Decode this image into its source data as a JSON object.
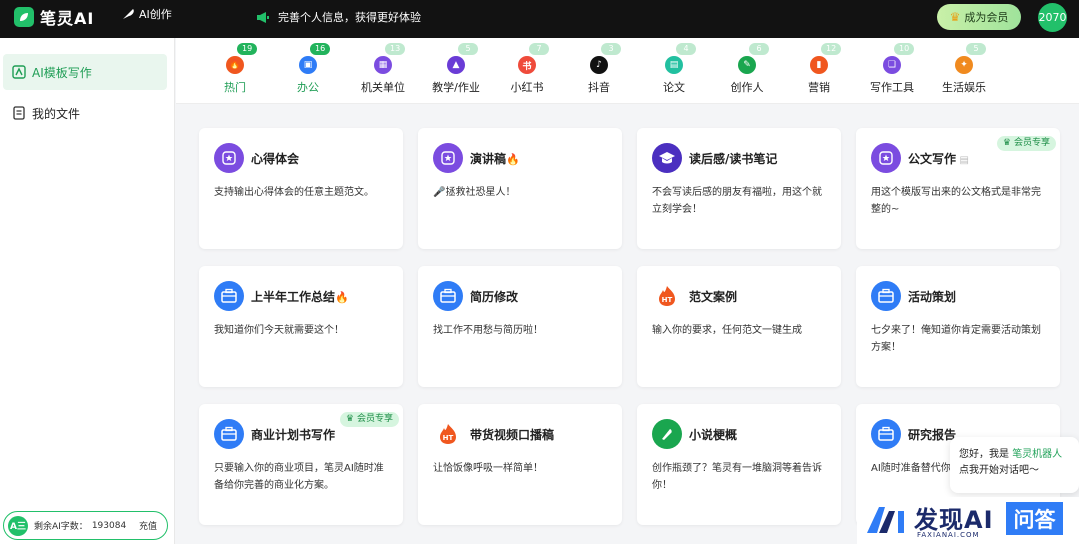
{
  "app": {
    "name": "笔灵AI"
  },
  "topbar": {
    "ai_create": "AI创作",
    "notice": "完善个人信息，获得更好体验",
    "vip_button": "成为会员",
    "user_avatar_text": "2070"
  },
  "sidebar": {
    "items": [
      {
        "label": "AI模板写作",
        "icon": "ai-template-icon",
        "active": true
      },
      {
        "label": "我的文件",
        "icon": "file-icon",
        "active": false
      }
    ],
    "words": {
      "icon_text": "A三",
      "label": "剩余AI字数：",
      "count": "193084",
      "recharge": "充值"
    }
  },
  "tabs": [
    {
      "label": "热门",
      "badge": "19",
      "icon": "fire-icon",
      "color": "#f0571f",
      "active": true
    },
    {
      "label": "办公",
      "badge": "16",
      "icon": "briefcase-icon",
      "color": "#2f7cf6",
      "active": true
    },
    {
      "label": "机关单位",
      "badge": "13",
      "icon": "government-icon",
      "color": "#7b4ce0",
      "active": false
    },
    {
      "label": "教学/作业",
      "badge": "5",
      "icon": "graduation-cap-icon",
      "color": "#6a3cd6",
      "active": false
    },
    {
      "label": "小红书",
      "badge": "7",
      "icon": "xiaohongshu-icon",
      "color": "#ef4b3b",
      "active": false
    },
    {
      "label": "抖音",
      "badge": "3",
      "icon": "tiktok-icon",
      "color": "#111111",
      "active": false
    },
    {
      "label": "论文",
      "badge": "4",
      "icon": "paper-icon",
      "color": "#22c0a0",
      "active": false
    },
    {
      "label": "创作人",
      "badge": "6",
      "icon": "pen-icon",
      "color": "#1aa64f",
      "active": false
    },
    {
      "label": "营销",
      "badge": "12",
      "icon": "marketing-icon",
      "color": "#f0571f",
      "active": false
    },
    {
      "label": "写作工具",
      "badge": "10",
      "icon": "writing-tool-icon",
      "color": "#7b4ce0",
      "active": false
    },
    {
      "label": "生活娱乐",
      "badge": "5",
      "icon": "lifestyle-icon",
      "color": "#f08a1f",
      "active": false
    }
  ],
  "cards": [
    {
      "title": "心得体会",
      "desc": "支持输出心得体会的任意主题范文。",
      "icon": "star-badge-icon",
      "color": "#7b4ce0",
      "fire": false,
      "vip": false
    },
    {
      "title": "演讲稿",
      "desc": "🎤拯救社恐星人！",
      "icon": "star-badge-icon",
      "color": "#7b4ce0",
      "fire": true,
      "vip": false
    },
    {
      "title": "读后感/读书笔记",
      "desc": "不会写读后感的朋友有福啦，用这个就立刻学会！",
      "icon": "graduation-cap-icon",
      "color": "#4b2fc0",
      "fire": false,
      "vip": false
    },
    {
      "title": "公文写作",
      "desc": "用这个模版写出来的公文格式是非常完整的~",
      "icon": "star-badge-icon",
      "color": "#7b4ce0",
      "fire": false,
      "vip": true,
      "doc": true
    },
    {
      "title": "上半年工作总结",
      "desc": "我知道你们今天就需要这个！",
      "icon": "briefcase-icon",
      "color": "#2f7cf6",
      "fire": true,
      "vip": false
    },
    {
      "title": "简历修改",
      "desc": "找工作不用愁与简历啦！",
      "icon": "briefcase-icon",
      "color": "#2f7cf6",
      "fire": false,
      "vip": false
    },
    {
      "title": "范文案例",
      "desc": "输入你的要求，任何范文一键生成",
      "icon": "ht-fire-icon",
      "color": "#f0571f",
      "fire": false,
      "vip": false
    },
    {
      "title": "活动策划",
      "desc": "七夕来了！俺知道你肯定需要活动策划方案！",
      "icon": "briefcase-icon",
      "color": "#2f7cf6",
      "fire": false,
      "vip": false
    },
    {
      "title": "商业计划书写作",
      "desc": "只要输入你的商业项目，笔灵AI随时准备给你完善的商业化方案。",
      "icon": "briefcase-icon",
      "color": "#2f7cf6",
      "fire": false,
      "vip": true
    },
    {
      "title": "带货视频口播稿",
      "desc": "让恰饭像呼吸一样简单！",
      "icon": "ht-fire-icon",
      "color": "#f0571f",
      "fire": false,
      "vip": false
    },
    {
      "title": "小说梗概",
      "desc": "创作瓶颈了？笔灵有一堆脑洞等着告诉你！",
      "icon": "pen-icon",
      "color": "#1aa64f",
      "fire": false,
      "vip": false
    },
    {
      "title": "研究报告",
      "desc": "AI随时准备替代你",
      "icon": "briefcase-icon",
      "color": "#2f7cf6",
      "fire": false,
      "vip": false
    }
  ],
  "vip_tag": "会员专享",
  "chat": {
    "greeting": "您好，我是",
    "bot_name": "笔灵机器人",
    "prompt": "点我开始对话吧～"
  },
  "watermark": {
    "main": "发现AI",
    "sub": "FAXIANAI.COM",
    "box": "问答"
  }
}
